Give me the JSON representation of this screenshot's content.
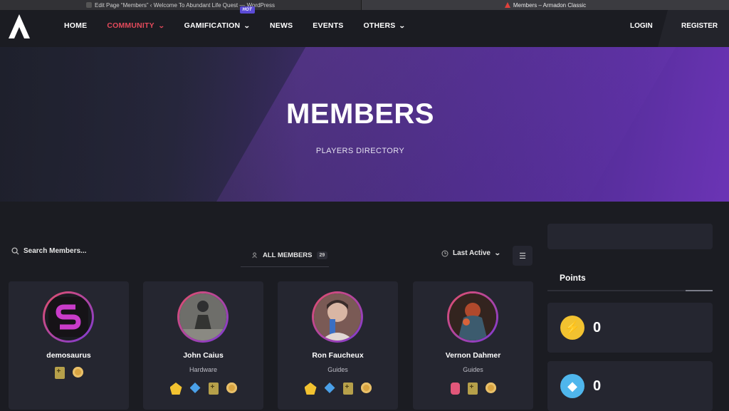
{
  "browser_tabs": [
    {
      "title": "Edit Page “Members” ‹ Welcome To Abundant Life Quest — WordPress"
    },
    {
      "title": "Members – Armadon Classic"
    }
  ],
  "nav": {
    "items": [
      {
        "label": "HOME"
      },
      {
        "label": "COMMUNITY"
      },
      {
        "label": "GAMIFICATION"
      },
      {
        "label": "NEWS"
      },
      {
        "label": "EVENTS"
      },
      {
        "label": "OTHERS"
      }
    ],
    "hot_badge": "HOT",
    "login": "LOGIN",
    "register": "REGISTER",
    "accent_color": "#e34a5b"
  },
  "hero": {
    "title": "MEMBERS",
    "subtitle": "PLAYERS DIRECTORY"
  },
  "directory": {
    "search_placeholder": "Search Members...",
    "tab_label": "ALL MEMBERS",
    "tab_count": "29",
    "sort_label": "Last Active"
  },
  "members": [
    {
      "name": "demosaurus",
      "role": "",
      "badges": [
        "shield-badge",
        "medal-badge"
      ]
    },
    {
      "name": "John Caius",
      "role": "Hardware",
      "badges": [
        "pentagon-badge",
        "diamond-badge",
        "shield-badge",
        "medal-badge"
      ]
    },
    {
      "name": "Ron Faucheux",
      "role": "Guides",
      "badges": [
        "pentagon-badge",
        "diamond-badge",
        "shield-badge",
        "medal-badge"
      ]
    },
    {
      "name": "Vernon Dahmer",
      "role": "Guides",
      "badges": [
        "gem-badge",
        "shield-badge",
        "medal-badge"
      ]
    }
  ],
  "sidebar": {
    "points_title": "Points",
    "points": [
      {
        "icon": "lightning-icon",
        "value": "0"
      },
      {
        "icon": "diamond-icon",
        "value": "0"
      }
    ]
  }
}
